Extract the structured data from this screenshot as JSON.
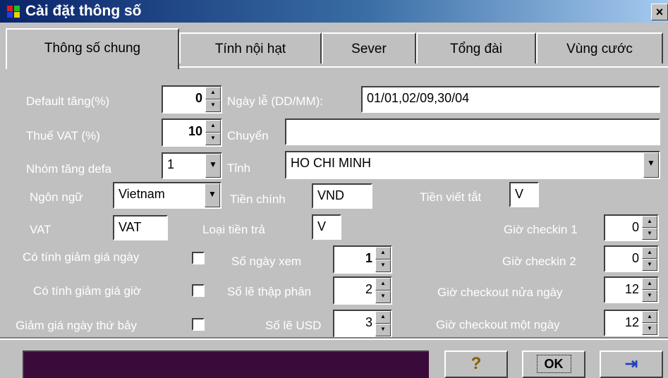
{
  "window": {
    "title": "Cài đặt thông số",
    "close_label": "×"
  },
  "tabs": [
    {
      "label": "Thông số chung",
      "active": true
    },
    {
      "label": "Tính nội hạt",
      "active": false
    },
    {
      "label": "Sever",
      "active": false
    },
    {
      "label": "Tổng đài",
      "active": false
    },
    {
      "label": "Vùng cước",
      "active": false
    }
  ],
  "form": {
    "default_tang": {
      "label": "Default tăng(%)",
      "value": "0"
    },
    "thue_vat": {
      "label": "Thuế VAT (%)",
      "value": "10"
    },
    "nhom_tang": {
      "label": "Nhóm tăng defa",
      "value": "1"
    },
    "ngon_ngu": {
      "label": "Ngôn ngữ",
      "value": "Vietnam"
    },
    "vat": {
      "label": "VAT",
      "value": "VAT"
    },
    "ngay_le": {
      "label": "Ngày lễ (DD/MM):",
      "value": "01/01,02/09,30/04"
    },
    "chuyen": {
      "label": "Chuyển",
      "value": ""
    },
    "tinh": {
      "label": "Tỉnh",
      "value": "HO CHI MINH"
    },
    "tien_chinh": {
      "label": "Tiền chính",
      "value": "VND"
    },
    "tien_viet_tat": {
      "label": "Tiền viết tắt",
      "value": "V"
    },
    "loai_tien_tra": {
      "label": "Loại tiền trả",
      "value": "V"
    },
    "co_tinh_giam_gia_ngay": {
      "label": "Có tính giảm giá ngày"
    },
    "co_tinh_giam_gia_gio": {
      "label": "Có tính giảm giá giờ"
    },
    "giam_gia_thu_bay": {
      "label": "Giảm giá ngày thứ bảy"
    },
    "so_ngay_xem": {
      "label": "Số ngày xem",
      "value": "1"
    },
    "so_le_thap_phan": {
      "label": "Số lẽ thập phân",
      "value": "2"
    },
    "so_le_usd": {
      "label": "Số lẽ USD",
      "value": "3"
    },
    "gio_checkin_1": {
      "label": "Giờ checkin 1",
      "value": "0"
    },
    "gio_checkin_2": {
      "label": "Giờ checkin 2",
      "value": "0"
    },
    "gio_checkout_nua_ngay": {
      "label": "Giờ checkout nửa ngày",
      "value": "12"
    },
    "gio_checkout_mot_ngay": {
      "label": "Giờ checkout một ngày",
      "value": "12"
    }
  },
  "footer": {
    "help_label": "?",
    "ok_label": "OK",
    "exit_label": "⇥"
  }
}
